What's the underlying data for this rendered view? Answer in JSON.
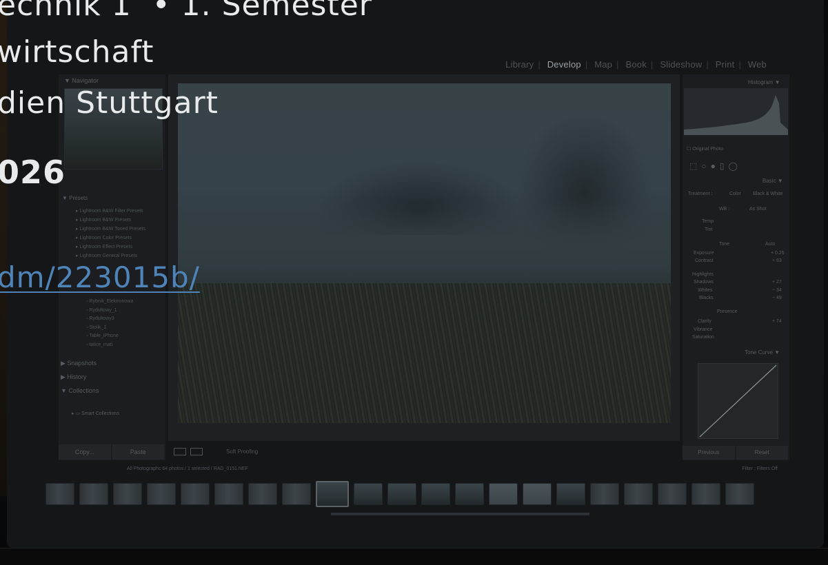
{
  "overlay": {
    "line1": "echnik 1  • 1. Semester",
    "line2": "wirtschaft",
    "line3": "dien Stuttgart",
    "year": "026",
    "link": "dm/223015b/"
  },
  "lightroom": {
    "modules": [
      "Library",
      "Develop",
      "Map",
      "Book",
      "Slideshow",
      "Print",
      "Web"
    ],
    "active_module": "Develop",
    "left_panel": {
      "navigator_label": "Navigator",
      "presets_label": "Presets",
      "presets": [
        "Lightroom B&W Filter Presets",
        "Lightroom B&W Presets",
        "Lightroom B&W Toned Presets",
        "Lightroom Color Presets",
        "Lightroom Effect Presets",
        "Lightroom General Presets"
      ],
      "folders": [
        "Rybnik_Elektronowa",
        "Rydultowy_1",
        "Rydultowy3",
        "Stolik_2",
        "Table_iPhone",
        "tatice_mati"
      ],
      "sections": [
        "Snapshots",
        "History",
        "Collections"
      ],
      "smart_collections": "Smart Collections",
      "copy_label": "Copy...",
      "paste_label": "Paste"
    },
    "center": {
      "soft_proofing": "Soft Proofing"
    },
    "right_panel": {
      "histogram_label": "Histogram",
      "original_photo": "Original Photo",
      "basic_label": "Basic",
      "treatment_label": "Treatment :",
      "treatment_color": "Color",
      "treatment_bw": "Black & White",
      "wb_label": "WB :",
      "wb_value": "As Shot",
      "temp_label": "Temp",
      "tint_label": "Tint",
      "tone_label": "Tone",
      "auto_label": "Auto",
      "exposure_label": "Exposure",
      "exposure_value": "+ 0.25",
      "contrast_label": "Contrast",
      "contrast_value": "+ 63",
      "highlights_label": "Highlights",
      "shadows_label": "Shadows",
      "shadows_value": "+ 27",
      "whites_label": "Whites",
      "whites_value": "− 34",
      "blacks_label": "Blacks",
      "blacks_value": "− 49",
      "presence_label": "Presence",
      "clarity_label": "Clarity",
      "clarity_value": "+ 74",
      "vibrance_label": "Vibrance",
      "saturation_label": "Saturation",
      "tone_curve_label": "Tone Curve",
      "previous_label": "Previous",
      "reset_label": "Reset"
    },
    "filmstrip": {
      "source": "All Photographs   64 photos / 1 selected / RAD_0151.NEF",
      "filter_label": "Filter :",
      "filter_value": "Filters Off"
    }
  }
}
